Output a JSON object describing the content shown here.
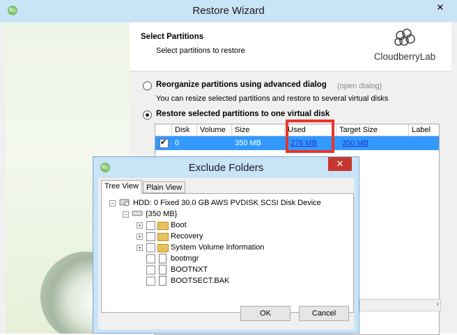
{
  "main_window": {
    "title": "Restore Wizard",
    "close": "✕"
  },
  "header": {
    "title": "Select Partitions",
    "subtitle": "Select partitions to restore",
    "brand": "CloudberryLab"
  },
  "options": {
    "advanced": {
      "label": "Reorganize partitions using advanced dialog",
      "link": "(open dialog)",
      "description": "You can resize selected partitions and restore to several virtual disks",
      "selected": false
    },
    "single": {
      "label": "Restore selected partitions to one virtual disk",
      "selected": true
    }
  },
  "grid": {
    "columns": [
      "Disk",
      "Volume",
      "Size",
      "Used",
      "Target Size",
      "Label"
    ],
    "rows": [
      {
        "checked": true,
        "disk": "0",
        "volume": "",
        "size": "350 MB",
        "used": "276 MB",
        "target_size": "350 MB",
        "label": ""
      }
    ]
  },
  "dialog": {
    "title": "Exclude Folders",
    "close": "✕",
    "tabs": [
      "Tree View",
      "Plain View"
    ],
    "active_tab": "Tree View",
    "tree": {
      "root": "HDD: 0 Fixed 30.0 GB AWS PVDISK SCSI Disk Device",
      "volume": "{350 MB}",
      "items": [
        "Boot",
        "Recovery",
        "System Volume Information",
        "bootmgr",
        "BOOTNXT",
        "BOOTSECT.BAK"
      ]
    },
    "ok_label": "OK",
    "cancel_label": "Cancel"
  },
  "colors": {
    "titlebar": "#c9e3f7",
    "selection": "#3399ff",
    "highlight_box": "#e8352a",
    "dialog_close": "#c7372d",
    "link": "#2233cc"
  }
}
